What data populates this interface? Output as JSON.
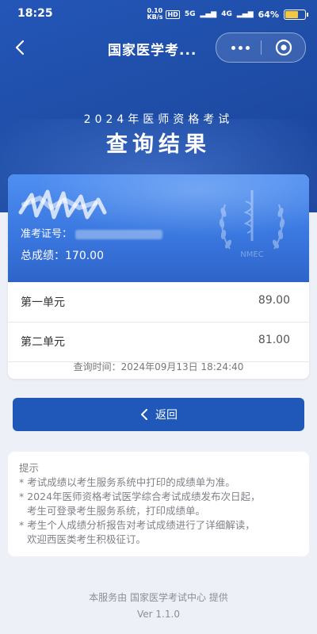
{
  "status_bar": {
    "time": "18:25",
    "speed": "0.10 KB/s",
    "hd": "HD",
    "net1": "5G",
    "net2": "4G",
    "battery": "64%"
  },
  "nav": {
    "title": "国家医学考...",
    "back_icon": "chevron-left-icon",
    "more_icon": "more-dots-icon",
    "close_icon": "target-circle-icon"
  },
  "header": {
    "subtitle": "2024年医师资格考试",
    "title": "查询结果"
  },
  "result_card": {
    "exam_id_label": "准考证号：",
    "total_score_text": "总成绩：170.00",
    "emblem_text": "NMEC",
    "units": [
      {
        "name": "第一单元",
        "score": "89.00"
      },
      {
        "name": "第二单元",
        "score": "81.00"
      }
    ],
    "query_time": "查询时间：2024年09月13日 18:24:40"
  },
  "return_button": {
    "label": "返回",
    "icon": "chevron-left-icon"
  },
  "tips": {
    "heading": "提示",
    "lines": [
      "* 考试成绩以考生服务系统中打印的成绩单为准。",
      "* 2024年医师资格考试医学综合考试成绩发布次日起，",
      "考生可登录考生服务系统，打印成绩单。",
      "* 考生个人成绩分析报告对考试成绩进行了详细解读，",
      "欢迎西医类考生积极征订。"
    ]
  },
  "footer": {
    "provider": "本服务由 国家医学考试中心 提供",
    "version": "Ver 1.1.0"
  },
  "colors": {
    "header_blue": "#1f4ea8",
    "card_blue": "#3a78e0",
    "button_blue": "#1f58b8",
    "page_bg": "#edf1f7"
  }
}
